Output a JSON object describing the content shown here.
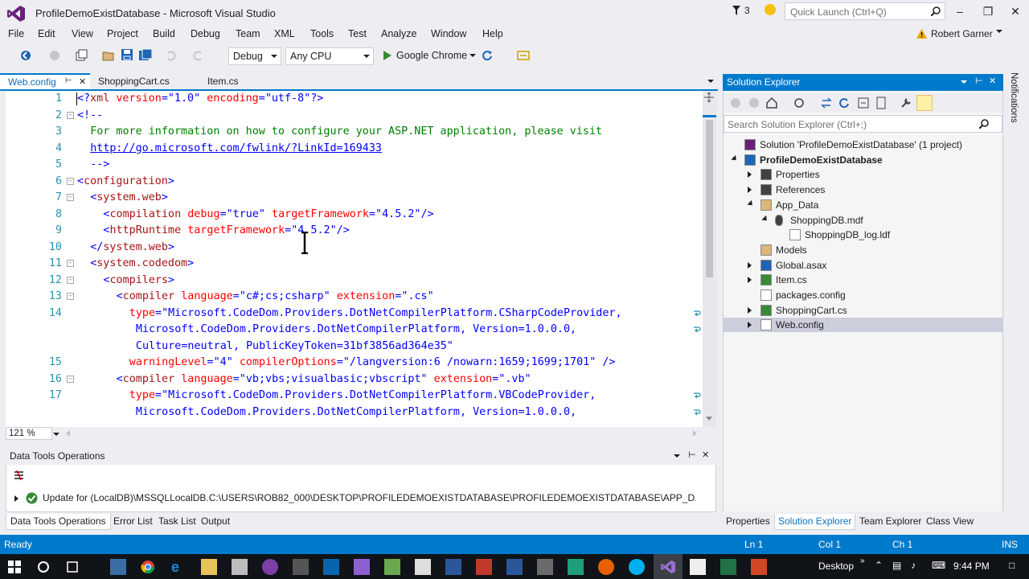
{
  "window": {
    "title": "ProfileDemoExistDatabase - Microsoft Visual Studio",
    "notification_count": "3",
    "quick_launch_placeholder": "Quick Launch (Ctrl+Q)",
    "user_name": "Robert Garner"
  },
  "menu": [
    "File",
    "Edit",
    "View",
    "Project",
    "Build",
    "Debug",
    "Team",
    "XML",
    "Tools",
    "Test",
    "Analyze",
    "Window",
    "Help"
  ],
  "toolbar": {
    "configuration": "Debug",
    "platform": "Any CPU",
    "run_target": "Google Chrome"
  },
  "editor_tabs": [
    {
      "label": "Web.config",
      "active": true
    },
    {
      "label": "ShoppingCart.cs",
      "active": false
    },
    {
      "label": "Item.cs",
      "active": false
    }
  ],
  "editor": {
    "zoom": "121 %",
    "lines": [
      {
        "n": "1",
        "fold": "",
        "indent": 0,
        "parts": [
          [
            "br",
            "<?"
          ],
          [
            "tag",
            "xml"
          ],
          [
            "attr",
            " version"
          ],
          [
            "br",
            "="
          ],
          [
            "val",
            "\"1.0\""
          ],
          [
            "attr",
            " encoding"
          ],
          [
            "br",
            "="
          ],
          [
            "val",
            "\"utf-8\""
          ],
          [
            "br",
            "?>"
          ]
        ]
      },
      {
        "n": "2",
        "fold": "-",
        "indent": 0,
        "parts": [
          [
            "br",
            "<!--"
          ]
        ]
      },
      {
        "n": "3",
        "fold": "",
        "indent": 2,
        "parts": [
          [
            "cmt",
            "For more information on how to configure your ASP.NET application, please visit"
          ]
        ]
      },
      {
        "n": "4",
        "fold": "",
        "indent": 2,
        "parts": [
          [
            "link",
            "http://go.microsoft.com/fwlink/?LinkId=169433"
          ]
        ]
      },
      {
        "n": "5",
        "fold": "",
        "indent": 2,
        "parts": [
          [
            "br",
            "-->"
          ]
        ]
      },
      {
        "n": "6",
        "fold": "-",
        "indent": 0,
        "parts": [
          [
            "br",
            "<"
          ],
          [
            "tag",
            "configuration"
          ],
          [
            "br",
            ">"
          ]
        ]
      },
      {
        "n": "7",
        "fold": "-",
        "indent": 2,
        "parts": [
          [
            "br",
            "<"
          ],
          [
            "tag",
            "system.web"
          ],
          [
            "br",
            ">"
          ]
        ]
      },
      {
        "n": "8",
        "fold": "",
        "indent": 4,
        "parts": [
          [
            "br",
            "<"
          ],
          [
            "tag",
            "compilation"
          ],
          [
            "attr",
            " debug"
          ],
          [
            "br",
            "="
          ],
          [
            "val",
            "\"true\""
          ],
          [
            "attr",
            " targetFramework"
          ],
          [
            "br",
            "="
          ],
          [
            "val",
            "\"4.5.2\""
          ],
          [
            "br",
            "/>"
          ]
        ]
      },
      {
        "n": "9",
        "fold": "",
        "indent": 4,
        "parts": [
          [
            "br",
            "<"
          ],
          [
            "tag",
            "httpRuntime"
          ],
          [
            "attr",
            " targetFramework"
          ],
          [
            "br",
            "="
          ],
          [
            "val",
            "\"4.5.2\""
          ],
          [
            "br",
            "/>"
          ]
        ]
      },
      {
        "n": "10",
        "fold": "",
        "indent": 2,
        "parts": [
          [
            "br",
            "</"
          ],
          [
            "tag",
            "system.web"
          ],
          [
            "br",
            ">"
          ]
        ]
      },
      {
        "n": "11",
        "fold": "-",
        "indent": 2,
        "parts": [
          [
            "br",
            "<"
          ],
          [
            "tag",
            "system.codedom"
          ],
          [
            "br",
            ">"
          ]
        ]
      },
      {
        "n": "12",
        "fold": "-",
        "indent": 4,
        "parts": [
          [
            "br",
            "<"
          ],
          [
            "tag",
            "compilers"
          ],
          [
            "br",
            ">"
          ]
        ]
      },
      {
        "n": "13",
        "fold": "-",
        "indent": 6,
        "parts": [
          [
            "br",
            "<"
          ],
          [
            "tag",
            "compiler"
          ],
          [
            "attr",
            " language"
          ],
          [
            "br",
            "="
          ],
          [
            "val",
            "\"c#;cs;csharp\""
          ],
          [
            "attr",
            " extension"
          ],
          [
            "br",
            "="
          ],
          [
            "val",
            "\".cs\""
          ]
        ]
      },
      {
        "n": "14",
        "fold": "",
        "indent": 8,
        "wrap": true,
        "parts": [
          [
            "attr",
            "type"
          ],
          [
            "br",
            "="
          ],
          [
            "val",
            "\"Microsoft.CodeDom.Providers.DotNetCompilerPlatform.CSharpCodeProvider,"
          ]
        ]
      },
      {
        "n": "",
        "fold": "",
        "indent": 9,
        "wrap": true,
        "parts": [
          [
            "val",
            "Microsoft.CodeDom.Providers.DotNetCompilerPlatform, Version=1.0.0.0,"
          ]
        ]
      },
      {
        "n": "",
        "fold": "",
        "indent": 9,
        "parts": [
          [
            "val",
            "Culture=neutral, PublicKeyToken=31bf3856ad364e35\""
          ]
        ]
      },
      {
        "n": "15",
        "fold": "",
        "indent": 8,
        "parts": [
          [
            "attr",
            "warningLevel"
          ],
          [
            "br",
            "="
          ],
          [
            "val",
            "\"4\""
          ],
          [
            "attr",
            " compilerOptions"
          ],
          [
            "br",
            "="
          ],
          [
            "val",
            "\"/langversion:6 /nowarn:1659;1699;1701\""
          ],
          [
            "br",
            " />"
          ]
        ]
      },
      {
        "n": "16",
        "fold": "-",
        "indent": 6,
        "parts": [
          [
            "br",
            "<"
          ],
          [
            "tag",
            "compiler"
          ],
          [
            "attr",
            " language"
          ],
          [
            "br",
            "="
          ],
          [
            "val",
            "\"vb;vbs;visualbasic;vbscript\""
          ],
          [
            "attr",
            " extension"
          ],
          [
            "br",
            "="
          ],
          [
            "val",
            "\".vb\""
          ]
        ]
      },
      {
        "n": "17",
        "fold": "",
        "indent": 8,
        "wrap": true,
        "parts": [
          [
            "attr",
            "type"
          ],
          [
            "br",
            "="
          ],
          [
            "val",
            "\"Microsoft.CodeDom.Providers.DotNetCompilerPlatform.VBCodeProvider,"
          ]
        ]
      },
      {
        "n": "",
        "fold": "",
        "indent": 9,
        "wrap": true,
        "parts": [
          [
            "val",
            "Microsoft.CodeDom.Providers.DotNetCompilerPlatform, Version=1.0.0.0,"
          ]
        ]
      }
    ]
  },
  "data_tools": {
    "title": "Data Tools Operations",
    "message": "Update for (LocalDB)\\MSSQLLocalDB.C:\\USERS\\ROB82_000\\DESKTOP\\PROFILEDEMOEXISTDATABASE\\PROFILEDEMOEXISTDATABASE\\APP_DATA\\SHOP...",
    "tabs": [
      "Data Tools Operations",
      "Error List",
      "Task List",
      "Output"
    ]
  },
  "solution_explorer": {
    "title": "Solution Explorer",
    "search_placeholder": "Search Solution Explorer (Ctrl+;)",
    "items": [
      {
        "label": "Solution 'ProfileDemoExistDatabase' (1 project)",
        "level": 0,
        "exp": "",
        "icon": "solution-icon",
        "bold": false
      },
      {
        "label": "ProfileDemoExistDatabase",
        "level": 0,
        "exp": "open",
        "icon": "web-project-icon",
        "bold": true
      },
      {
        "label": "Properties",
        "level": 1,
        "exp": "closed",
        "icon": "wrench-icon",
        "bold": false
      },
      {
        "label": "References",
        "level": 1,
        "exp": "closed",
        "icon": "references-icon",
        "bold": false
      },
      {
        "label": "App_Data",
        "level": 1,
        "exp": "open",
        "icon": "folder-icon",
        "bold": false
      },
      {
        "label": "ShoppingDB.mdf",
        "level": 2,
        "exp": "open",
        "icon": "database-icon",
        "bold": false
      },
      {
        "label": "ShoppingDB_log.ldf",
        "level": 3,
        "exp": "",
        "icon": "file-icon",
        "bold": false
      },
      {
        "label": "Models",
        "level": 1,
        "exp": "",
        "icon": "folder-icon",
        "bold": false
      },
      {
        "label": "Global.asax",
        "level": 1,
        "exp": "closed",
        "icon": "global-icon",
        "bold": false
      },
      {
        "label": "Item.cs",
        "level": 1,
        "exp": "closed",
        "icon": "csharp-file-icon",
        "bold": false
      },
      {
        "label": "packages.config",
        "level": 1,
        "exp": "",
        "icon": "config-file-icon",
        "bold": false
      },
      {
        "label": "ShoppingCart.cs",
        "level": 1,
        "exp": "closed",
        "icon": "csharp-file-icon",
        "bold": false
      },
      {
        "label": "Web.config",
        "level": 1,
        "exp": "closed",
        "icon": "config-file-icon",
        "bold": false,
        "selected": true
      }
    ],
    "tabs": [
      "Properties",
      "Solution Explorer",
      "Team Explorer",
      "Class View"
    ]
  },
  "notifications_label": "Notifications",
  "status_bar": {
    "state": "Ready",
    "line": "Ln 1",
    "col": "Col 1",
    "ch": "Ch 1",
    "mode": "INS"
  },
  "taskbar": {
    "desktop_label": "Desktop",
    "clock": "9:44 PM"
  },
  "colors": {
    "accent": "#007acc",
    "xml_tag": "#a31515",
    "xml_attr": "#ff0000",
    "xml_value": "#0000ff",
    "comment": "#008000",
    "line_number": "#2b91af"
  }
}
